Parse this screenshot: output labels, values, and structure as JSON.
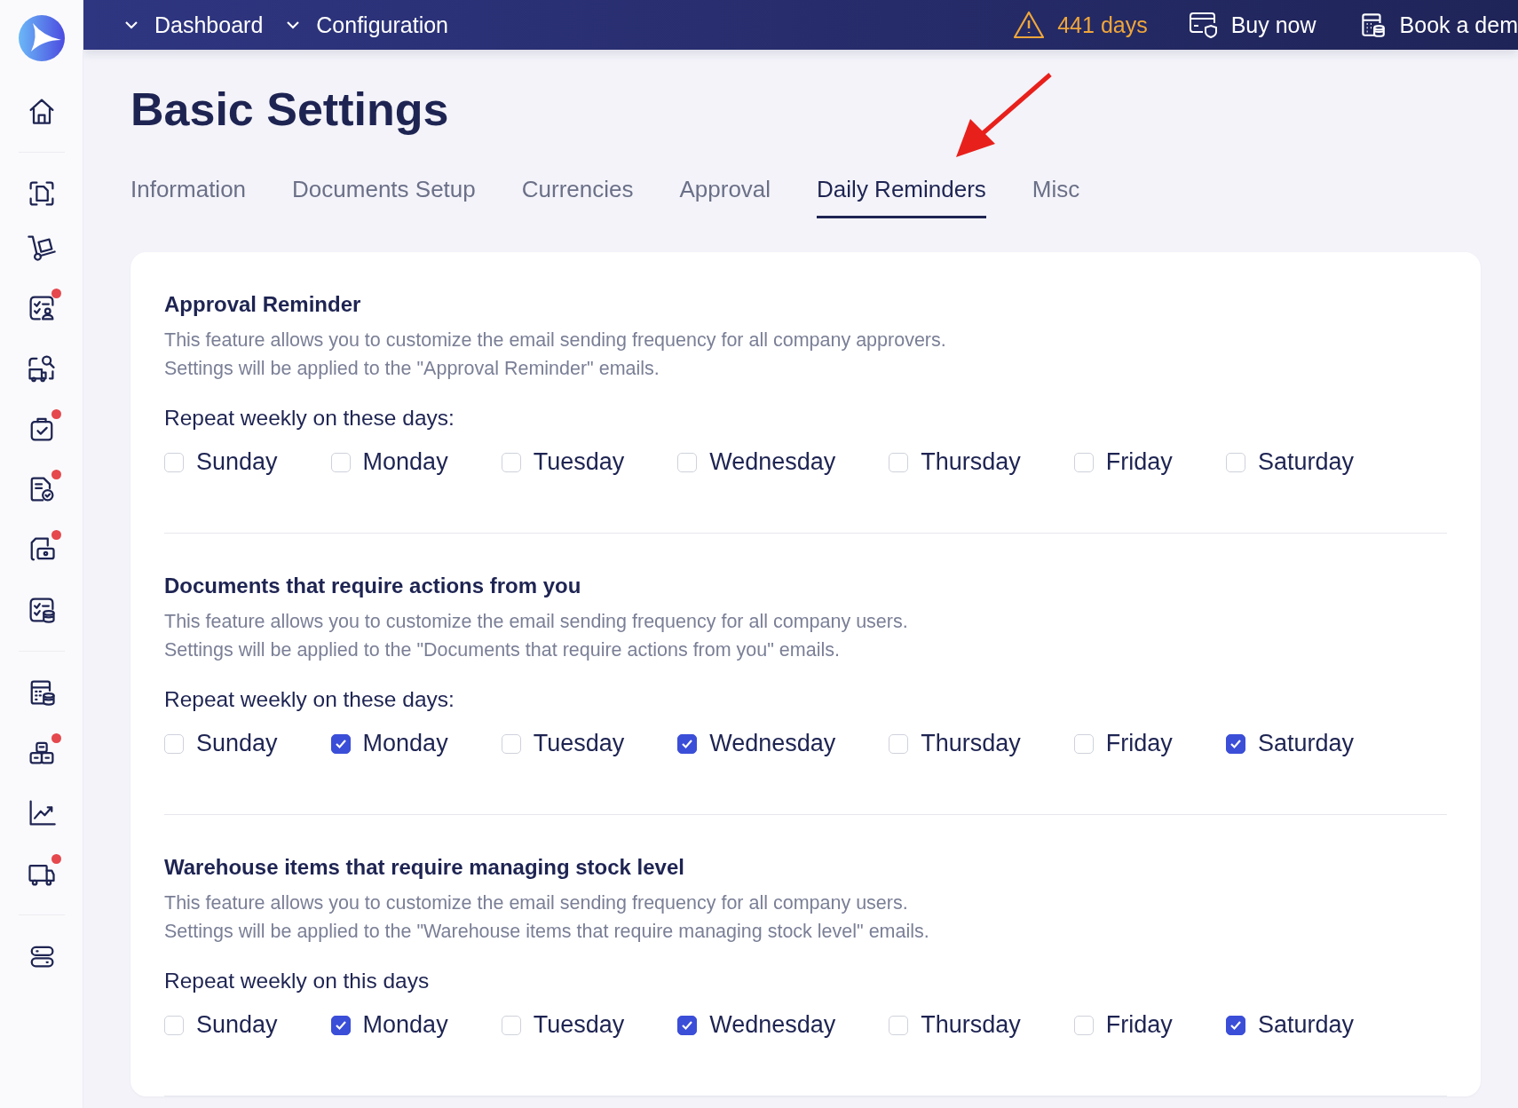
{
  "sidebar": {
    "items": [
      {
        "badge": false
      },
      {
        "badge": false
      },
      {
        "badge": false
      },
      {
        "badge": false
      },
      {
        "badge": true
      },
      {
        "badge": false
      },
      {
        "badge": true
      },
      {
        "badge": true
      },
      {
        "badge": true
      },
      {
        "badge": false
      },
      {
        "badge": false
      },
      {
        "badge": true
      },
      {
        "badge": false
      },
      {
        "badge": true
      },
      {
        "badge": false
      }
    ]
  },
  "top_bar": {
    "menus": [
      "Dashboard",
      "Configuration"
    ],
    "trial": "441 days",
    "buy": "Buy now",
    "demo": "Book a dem"
  },
  "page_title": "Basic Settings",
  "tabs": [
    {
      "label": "Information",
      "selected": false
    },
    {
      "label": "Documents Setup",
      "selected": false
    },
    {
      "label": "Currencies",
      "selected": false
    },
    {
      "label": "Approval",
      "selected": false
    },
    {
      "label": "Daily Reminders",
      "selected": true
    },
    {
      "label": "Misc",
      "selected": false
    }
  ],
  "sections": [
    {
      "title": "Approval Reminder",
      "description": [
        "This feature allows you to customize the email sending frequency for all company approvers.",
        "Settings will be applied to the \"Approval Reminder\" emails."
      ],
      "repeat_label": "Repeat weekly on these days:",
      "days": [
        {
          "label": "Sunday",
          "checked": false
        },
        {
          "label": "Monday",
          "checked": false
        },
        {
          "label": "Tuesday",
          "checked": false
        },
        {
          "label": "Wednesday",
          "checked": false
        },
        {
          "label": "Thursday",
          "checked": false
        },
        {
          "label": "Friday",
          "checked": false
        },
        {
          "label": "Saturday",
          "checked": false
        }
      ]
    },
    {
      "title": "Documents that require actions from you",
      "description": [
        "This feature allows you to customize the email sending frequency for all company users.",
        "Settings will be applied to the \"Documents that require actions from you\" emails."
      ],
      "repeat_label": "Repeat weekly on these days:",
      "days": [
        {
          "label": "Sunday",
          "checked": false
        },
        {
          "label": "Monday",
          "checked": true
        },
        {
          "label": "Tuesday",
          "checked": false
        },
        {
          "label": "Wednesday",
          "checked": true
        },
        {
          "label": "Thursday",
          "checked": false
        },
        {
          "label": "Friday",
          "checked": false
        },
        {
          "label": "Saturday",
          "checked": true
        }
      ]
    },
    {
      "title": "Warehouse items that require managing stock level",
      "description": [
        "This feature allows you to customize the email sending frequency for all company users.",
        "Settings will be applied to the \"Warehouse items that require managing stock level\" emails."
      ],
      "repeat_label": "Repeat weekly on this days",
      "days": [
        {
          "label": "Sunday",
          "checked": false
        },
        {
          "label": "Monday",
          "checked": true
        },
        {
          "label": "Tuesday",
          "checked": false
        },
        {
          "label": "Wednesday",
          "checked": true
        },
        {
          "label": "Thursday",
          "checked": false
        },
        {
          "label": "Friday",
          "checked": false
        },
        {
          "label": "Saturday",
          "checked": true
        }
      ]
    }
  ]
}
